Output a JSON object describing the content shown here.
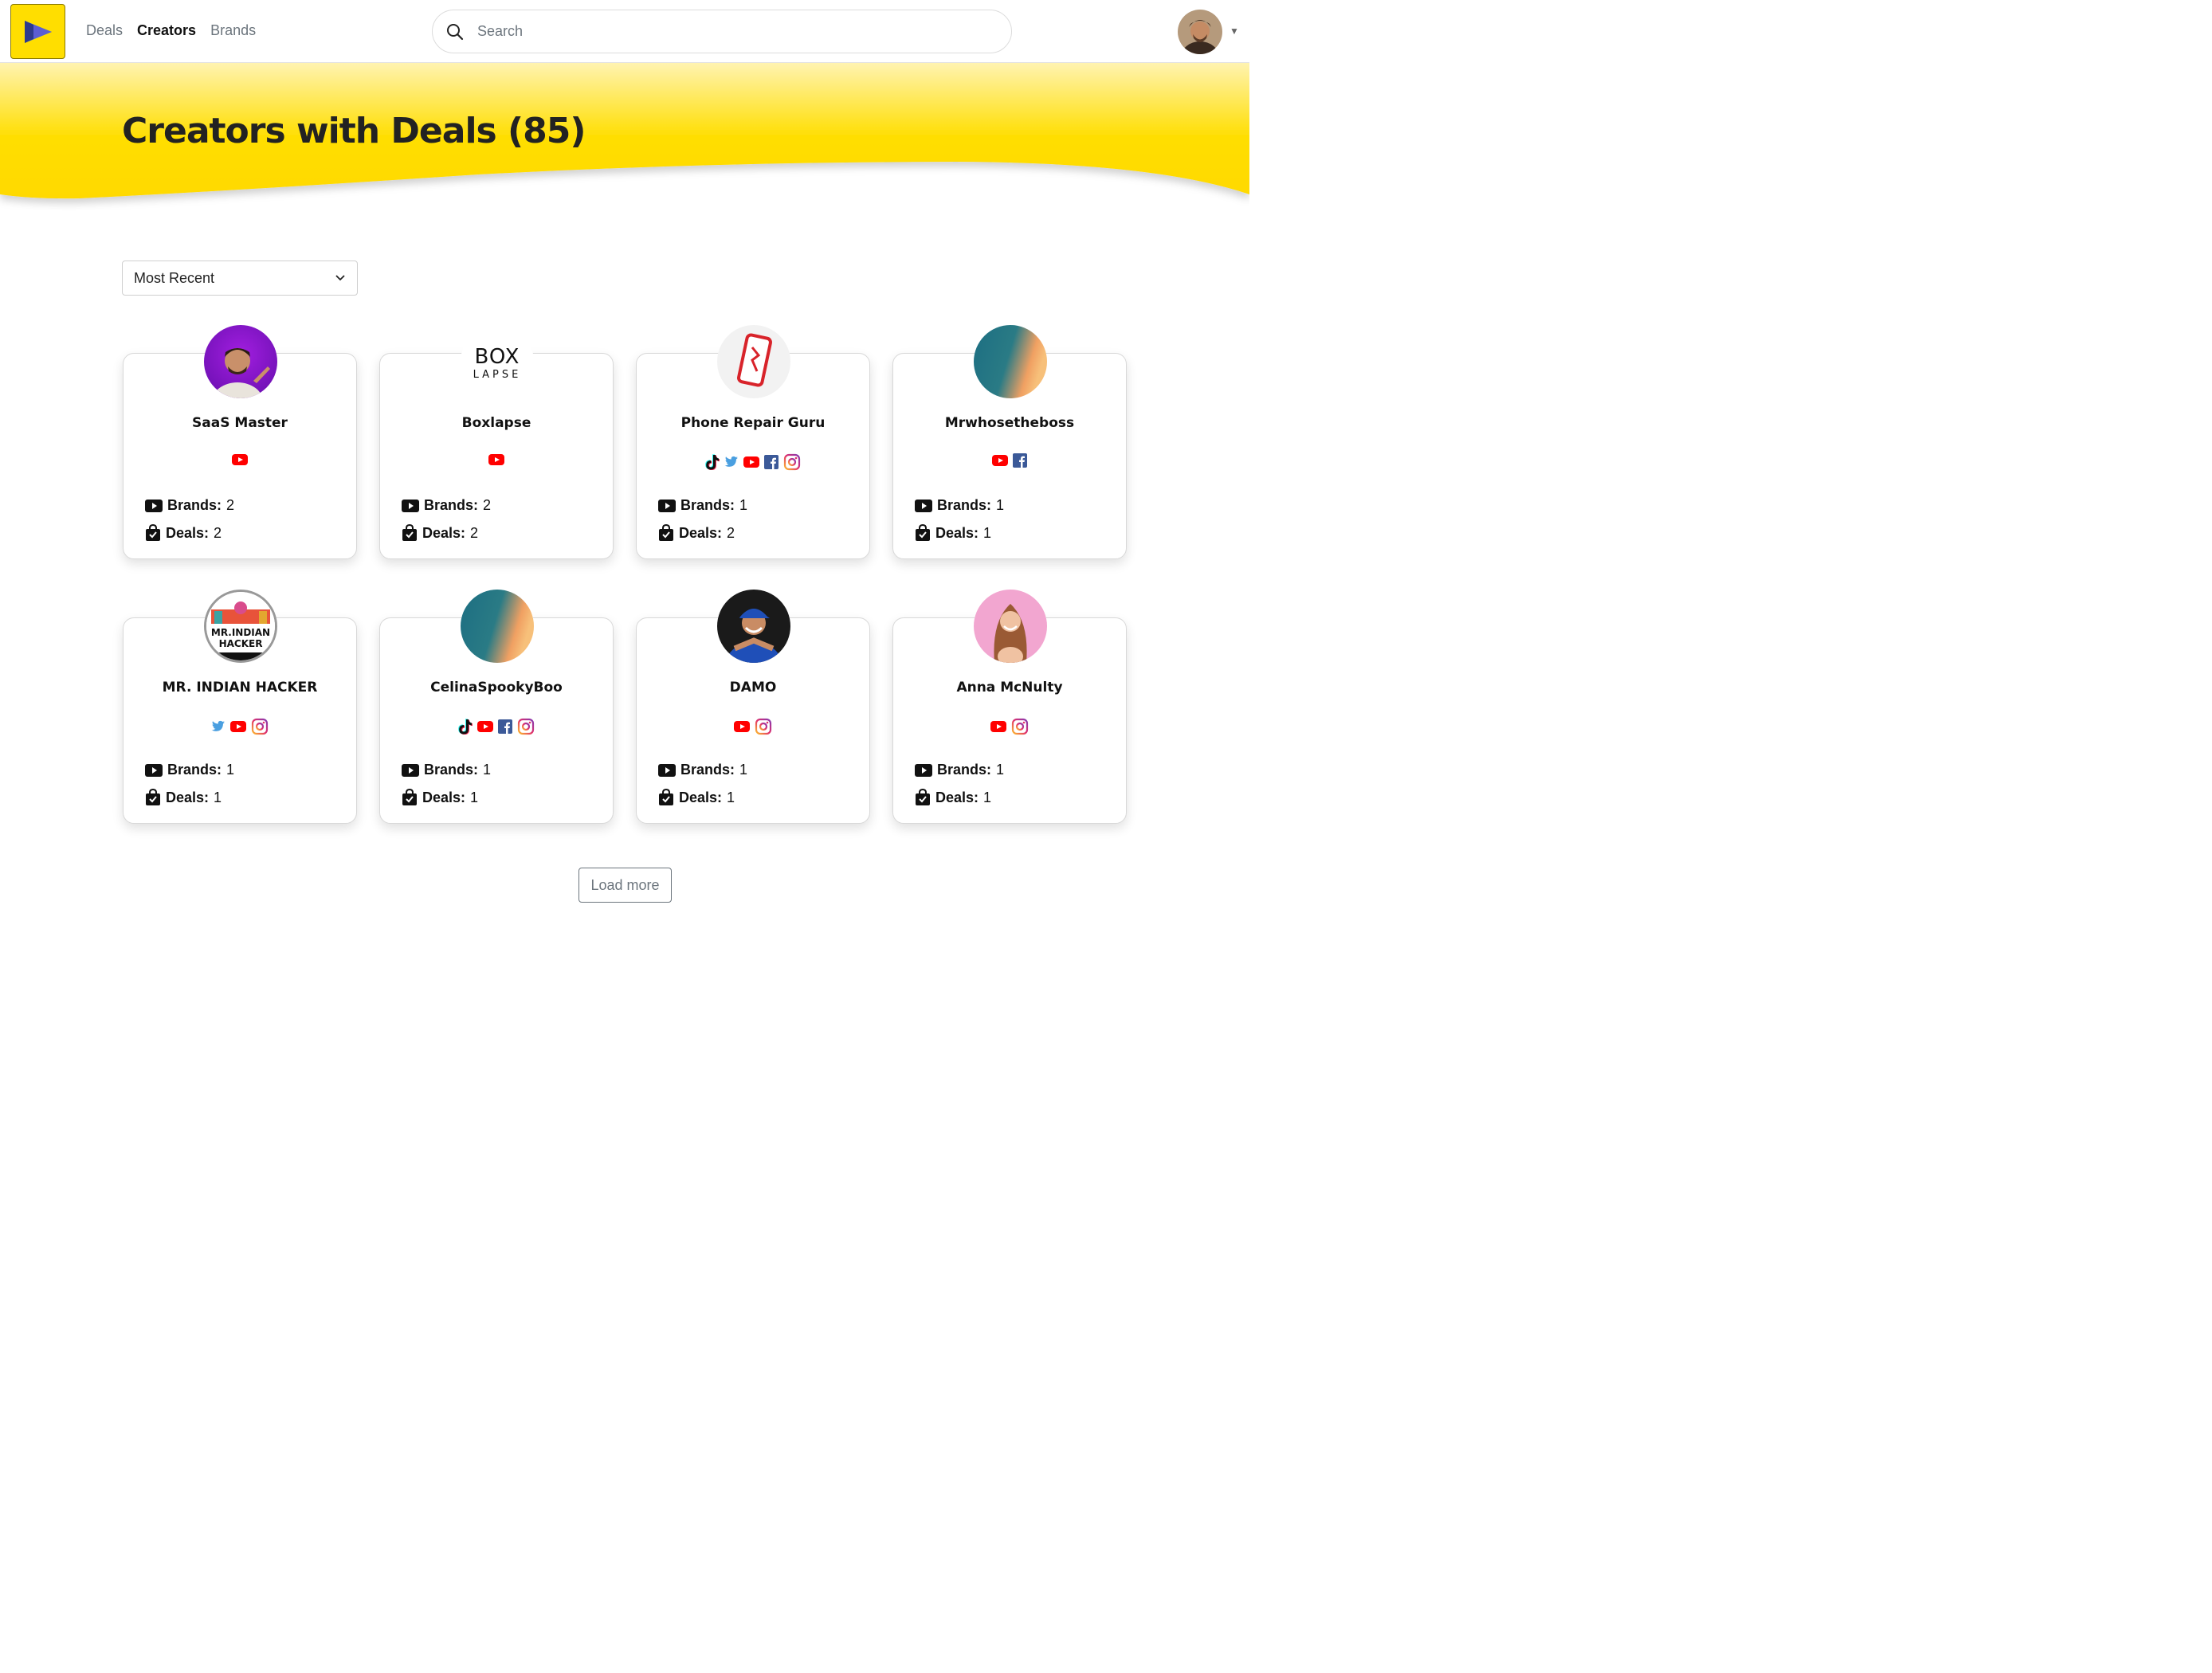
{
  "nav": {
    "items": [
      {
        "label": "Deals",
        "active": false
      },
      {
        "label": "Creators",
        "active": true
      },
      {
        "label": "Brands",
        "active": false
      }
    ]
  },
  "search": {
    "placeholder": "Search"
  },
  "banner": {
    "title": "Creators with Deals (85)"
  },
  "sort": {
    "selected": "Most Recent"
  },
  "cards": [
    {
      "name": "SaaS Master",
      "socials": [
        "youtube"
      ],
      "brands_label": "Brands:",
      "brands": "2",
      "deals_label": "Deals:",
      "deals": "2"
    },
    {
      "name": "Boxlapse",
      "socials": [
        "youtube"
      ],
      "brands_label": "Brands:",
      "brands": "2",
      "deals_label": "Deals:",
      "deals": "2",
      "logo_text": [
        "BOX",
        "LAPSE"
      ]
    },
    {
      "name": "Phone Repair Guru",
      "socials": [
        "tiktok",
        "twitter",
        "youtube",
        "facebook",
        "instagram"
      ],
      "brands_label": "Brands:",
      "brands": "1",
      "deals_label": "Deals:",
      "deals": "2"
    },
    {
      "name": "Mrwhosetheboss",
      "socials": [
        "youtube",
        "facebook"
      ],
      "brands_label": "Brands:",
      "brands": "1",
      "deals_label": "Deals:",
      "deals": "1"
    },
    {
      "name": "MR. INDIAN HACKER",
      "socials": [
        "twitter",
        "youtube",
        "instagram"
      ],
      "brands_label": "Brands:",
      "brands": "1",
      "deals_label": "Deals:",
      "deals": "1",
      "logo_text": [
        "MR.INDIAN",
        "HACKER"
      ]
    },
    {
      "name": "CelinaSpookyBoo",
      "socials": [
        "tiktok",
        "youtube",
        "facebook",
        "instagram"
      ],
      "brands_label": "Brands:",
      "brands": "1",
      "deals_label": "Deals:",
      "deals": "1"
    },
    {
      "name": "DAMO",
      "socials": [
        "youtube",
        "instagram"
      ],
      "brands_label": "Brands:",
      "brands": "1",
      "deals_label": "Deals:",
      "deals": "1"
    },
    {
      "name": "Anna McNulty",
      "socials": [
        "youtube",
        "instagram"
      ],
      "brands_label": "Brands:",
      "brands": "1",
      "deals_label": "Deals:",
      "deals": "1"
    }
  ],
  "load_more": {
    "label": "Load more"
  },
  "colors": {
    "brand_yellow": "#ffde00",
    "youtube": "#ff0000",
    "facebook": "#3b5998",
    "twitter": "#1da1f2"
  }
}
